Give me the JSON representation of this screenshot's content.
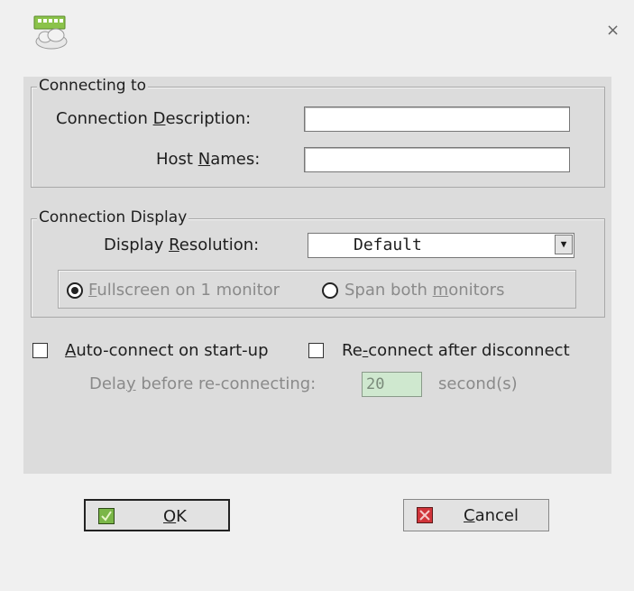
{
  "window": {
    "close_glyph": "×",
    "icon": "remote-desktop-icon"
  },
  "connecting_to": {
    "legend": "Connecting to",
    "description_label_pre": "Connection ",
    "description_label_u": "D",
    "description_label_post": "escription:",
    "description_value": "",
    "hostnames_label_pre": "Host ",
    "hostnames_label_u": "N",
    "hostnames_label_post": "ames:",
    "hostnames_value": ""
  },
  "connection_display": {
    "legend": "Connection Display",
    "resolution_label_pre": "Display ",
    "resolution_label_u": "R",
    "resolution_label_post": "esolution:",
    "resolution_value": "Default",
    "radio_fullscreen_u": "F",
    "radio_fullscreen_rest": "ullscreen on 1 monitor",
    "radio_span_pre": "Span both ",
    "radio_span_u": "m",
    "radio_span_post": "onitors",
    "selected_radio": "fullscreen"
  },
  "options": {
    "auto_connect_u": "A",
    "auto_connect_rest": "uto-connect on start-up",
    "auto_connect_checked": false,
    "reconnect_pre": "Re",
    "reconnect_u": "-",
    "reconnect_post": "connect after disconnect",
    "reconnect_checked": false,
    "delay_label_pre": "Dela",
    "delay_label_u": "y",
    "delay_label_post": " before re-connecting:",
    "delay_value": "20",
    "delay_unit": "second(s)"
  },
  "buttons": {
    "ok_u": "O",
    "ok_rest": "K",
    "cancel_u": "C",
    "cancel_rest": "ancel"
  },
  "colors": {
    "ok_icon": "#7ab648",
    "cancel_icon": "#d0343a",
    "delay_field_bg": "#cfe8cf"
  }
}
